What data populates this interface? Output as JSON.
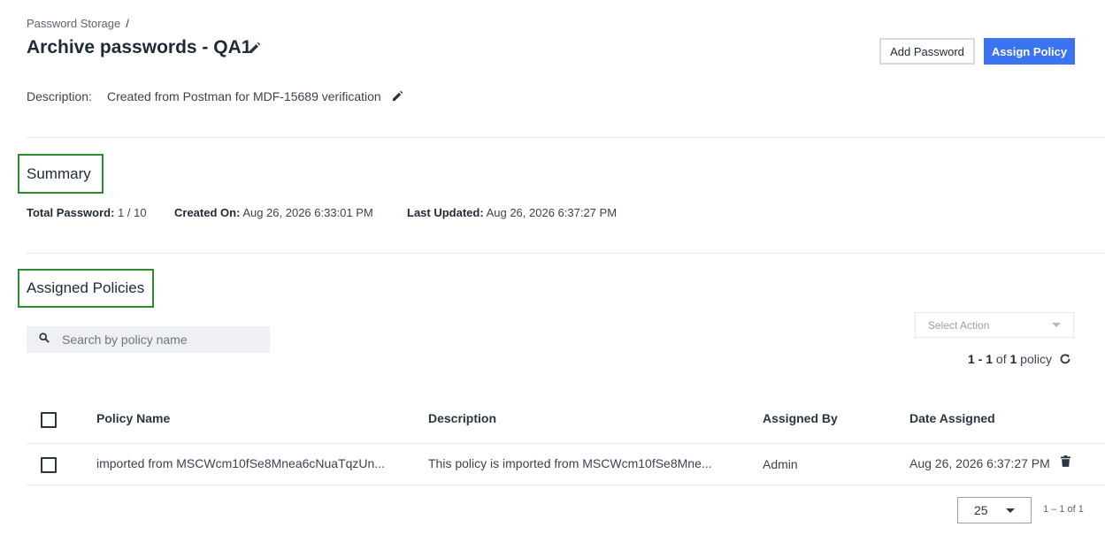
{
  "breadcrumb": {
    "root": "Password Storage",
    "separator": "/"
  },
  "header": {
    "title": "Archive passwords - QA1",
    "add_password_label": "Add Password",
    "assign_policy_label": "Assign Policy"
  },
  "description": {
    "label": "Description:",
    "value": "Created from Postman for MDF-15689 verification"
  },
  "summary": {
    "heading": "Summary",
    "total_password_label": "Total Password:",
    "total_password_value": "1 / 10",
    "created_on_label": "Created On:",
    "created_on_value": "Aug 26, 2026 6:33:01 PM",
    "last_updated_label": "Last Updated:",
    "last_updated_value": "Aug 26, 2026 6:37:27 PM"
  },
  "policies": {
    "heading": "Assigned Policies",
    "search_placeholder": "Search by policy name",
    "select_action": "Select Action",
    "count": {
      "range": "1 - 1",
      "of": "of",
      "total": "1",
      "unit": "policy"
    },
    "columns": {
      "policy_name": "Policy Name",
      "description": "Description",
      "assigned_by": "Assigned By",
      "date_assigned": "Date Assigned"
    },
    "rows": [
      {
        "policy_name": "imported from MSCWcm10fSe8Mnea6cNuaTqzUn...",
        "description": "This policy is imported from MSCWcm10fSe8Mne...",
        "assigned_by": "Admin",
        "date_assigned": "Aug 26, 2026 6:37:27 PM"
      }
    ],
    "pagination": {
      "per_page": "25",
      "range": "1 – 1 of 1"
    }
  },
  "colors": {
    "primary": "#3b73f0",
    "highlight_border": "#2e8b2e"
  },
  "icons": [
    "pencil-icon",
    "search-icon",
    "chevron-down-icon",
    "refresh-icon",
    "trash-icon"
  ]
}
